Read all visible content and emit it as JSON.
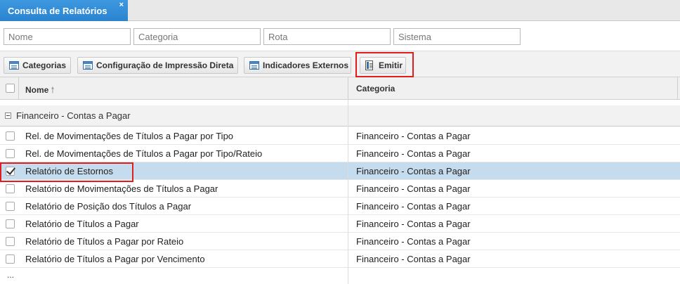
{
  "tab": {
    "title": "Consulta de Relatórios",
    "close_glyph": "×"
  },
  "filters": {
    "nome_placeholder": "Nome",
    "categoria_placeholder": "Categoria",
    "rota_placeholder": "Rota",
    "sistema_placeholder": "Sistema"
  },
  "toolbar": {
    "categorias_label": "Categorias",
    "config_label": "Configuração de Impressão Direta",
    "indicadores_label": "Indicadores Externos",
    "emitir_label": "Emitir"
  },
  "grid": {
    "col_nome": "Nome",
    "col_categoria": "Categoria",
    "sort_glyph": "🠕",
    "group_label": "Financeiro - Contas a Pagar",
    "more_glyph": "..."
  },
  "rows": [
    {
      "name": "Rel. de Movimentações de Títulos a Pagar por Tipo",
      "category": "Financeiro - Contas a Pagar",
      "checked": false
    },
    {
      "name": "Rel. de Movimentações de Títulos a Pagar por Tipo/Rateio",
      "category": "Financeiro - Contas a Pagar",
      "checked": false
    },
    {
      "name": "Relatório de Estornos",
      "category": "Financeiro - Contas a Pagar",
      "checked": true
    },
    {
      "name": "Relatório de Movimentações de Títulos a Pagar",
      "category": "Financeiro - Contas a Pagar",
      "checked": false
    },
    {
      "name": "Relatório de Posição dos Títulos a Pagar",
      "category": "Financeiro - Contas a Pagar",
      "checked": false
    },
    {
      "name": "Relatório de Títulos a Pagar",
      "category": "Financeiro - Contas a Pagar",
      "checked": false
    },
    {
      "name": "Relatório de Títulos a Pagar por Rateio",
      "category": "Financeiro - Contas a Pagar",
      "checked": false
    },
    {
      "name": "Relatório de Títulos a Pagar por Vencimento",
      "category": "Financeiro - Contas a Pagar",
      "checked": false
    }
  ],
  "colors": {
    "tab_blue": "#2a83cf",
    "selected_row": "#c5dcef",
    "highlight_red": "#e01e1e"
  }
}
